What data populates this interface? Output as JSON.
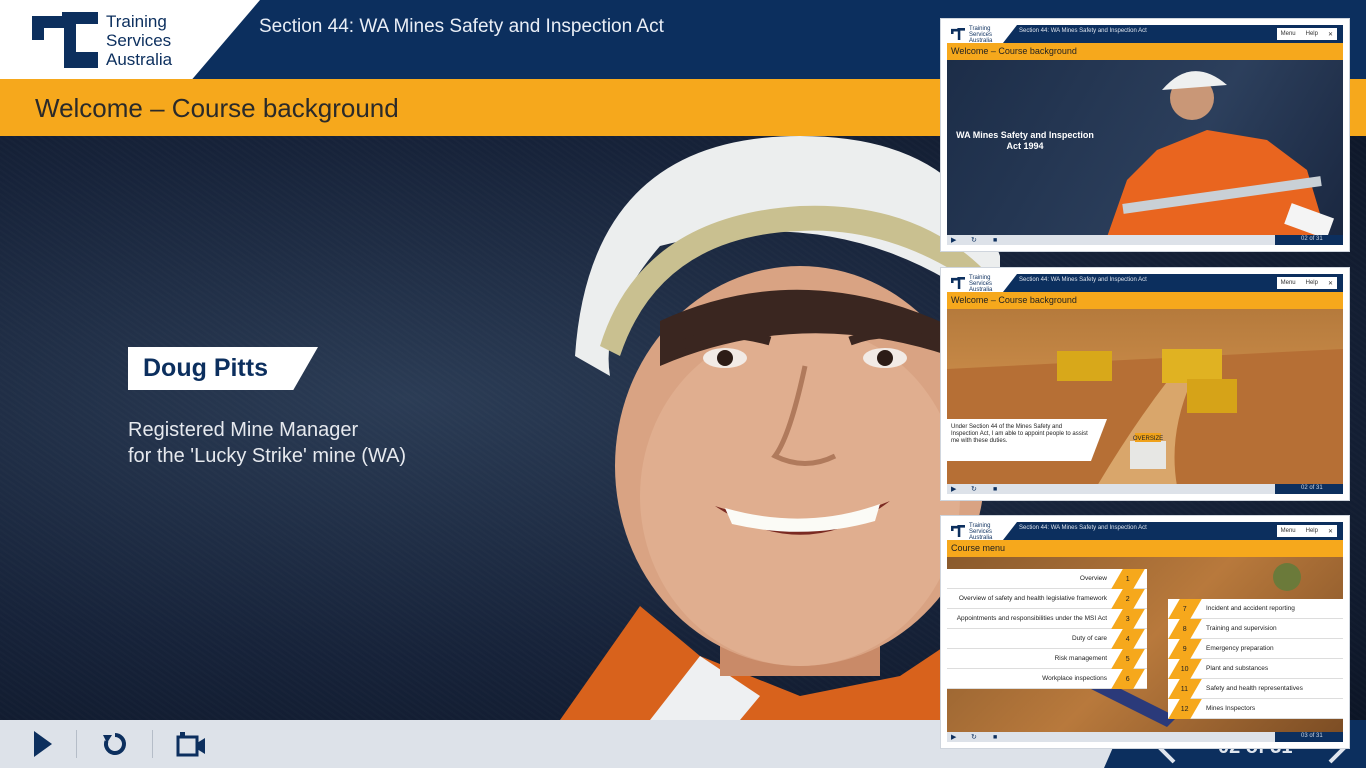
{
  "logo": {
    "line1": "Training",
    "line2": "Services",
    "line3": "Australia"
  },
  "header": {
    "section_title": "Section 44: WA Mines Safety and Inspection Act"
  },
  "slide": {
    "title": "Welcome – Course background"
  },
  "presenter": {
    "name": "Doug Pitts",
    "role_line1": "Registered Mine Manager",
    "role_line2": "for the 'Lucky Strike' mine (WA)"
  },
  "controls": {
    "play_icon": "play-icon",
    "replay_icon": "replay-icon",
    "video_icon": "video-camera-icon"
  },
  "pagination": {
    "current": "02 of 31"
  },
  "colors": {
    "navy": "#0c2f5e",
    "accent": "#f6a81c",
    "control_bg": "#dde2e9"
  },
  "thumbnails": [
    {
      "section": "Section 44: WA Mines Safety and Inspection Act",
      "title": "Welcome – Course background",
      "menu": "Menu",
      "help": "Help",
      "close": "✕",
      "caption": "WA Mines Safety and Inspection Act 1994",
      "page": "02 of 31"
    },
    {
      "section": "Section 44: WA Mines Safety and Inspection Act",
      "title": "Welcome – Course background",
      "menu": "Menu",
      "help": "Help",
      "close": "✕",
      "caption": "Under Section 44 of the Mines Safety and Inspection Act, I am able to appoint people to assist me with these duties.",
      "sign": "OVERSIZE",
      "page": "02 of 31"
    },
    {
      "section": "Section 44: WA Mines Safety and Inspection Act",
      "title": "Course menu",
      "menu": "Menu",
      "help": "Help",
      "close": "✕",
      "page": "03 of 31",
      "items_left": [
        {
          "num": "1",
          "label": "Overview"
        },
        {
          "num": "2",
          "label": "Overview of safety and health legislative framework"
        },
        {
          "num": "3",
          "label": "Appointments and responsibilities under the MSI Act"
        },
        {
          "num": "4",
          "label": "Duty of care"
        },
        {
          "num": "5",
          "label": "Risk management"
        },
        {
          "num": "6",
          "label": "Workplace inspections"
        }
      ],
      "items_right": [
        {
          "num": "7",
          "label": "Incident and accident reporting"
        },
        {
          "num": "8",
          "label": "Training and supervision"
        },
        {
          "num": "9",
          "label": "Emergency preparation"
        },
        {
          "num": "10",
          "label": "Plant and substances"
        },
        {
          "num": "11",
          "label": "Safety and health representatives"
        },
        {
          "num": "12",
          "label": "Mines Inspectors"
        }
      ]
    }
  ]
}
